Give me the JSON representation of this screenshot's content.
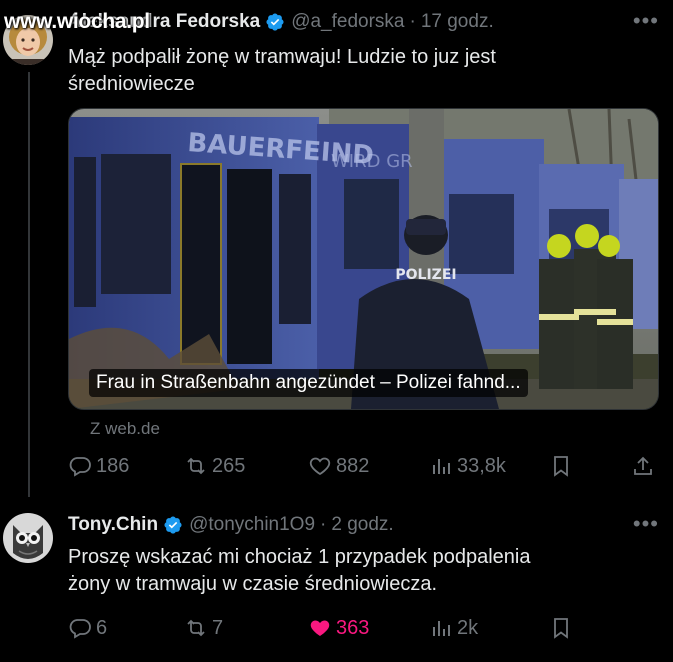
{
  "watermark": "www.wiocha.pl",
  "tweet1": {
    "name": "Aleksandra Fedorska",
    "handle": "@a_fedorska",
    "time": "17 godz.",
    "text_line1": "Mąż podpalił żonę w tramwaju! Ludzie to juz jest",
    "text_line2": "średniowiecze",
    "media": {
      "tram_lettering_1": "BAUERFEIND",
      "tram_lettering_2": "WIRD GR",
      "police_label": "POLIZEI",
      "caption": "Frau in Straßenbahn angezündet – Polizei fahnd..."
    },
    "source": "Z web.de",
    "stats": {
      "replies": "186",
      "reposts": "265",
      "likes": "882",
      "views": "33,8k"
    }
  },
  "tweet2": {
    "name": "Tony.Chin",
    "handle": "@tonychin1О9",
    "time": "2 godz.",
    "text_line1": "Proszę wskazać mi chociaż 1 przypadek podpalenia",
    "text_line2": "żony w tramwaju w czasie średniowiecza.",
    "stats": {
      "replies": "6",
      "reposts": "7",
      "likes": "363",
      "views": "2k"
    }
  },
  "icons": {
    "reply": "reply-icon",
    "repost": "repost-icon",
    "like": "heart-icon",
    "views": "views-icon",
    "bookmark": "bookmark-icon",
    "share": "share-icon",
    "verified": "verified-badge-icon",
    "more": "more-icon"
  },
  "colors": {
    "background": "#000000",
    "text": "#e7e9ea",
    "muted": "#71767b",
    "verified": "#1d9bf0",
    "liked": "#f91880"
  }
}
